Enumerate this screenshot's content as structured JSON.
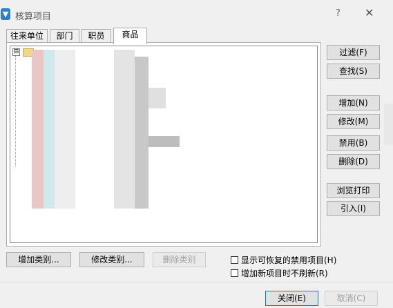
{
  "window": {
    "title": "核算项目",
    "help": "?",
    "close": "✕"
  },
  "tabs": [
    {
      "label": "往来单位"
    },
    {
      "label": "部门"
    },
    {
      "label": "职员"
    },
    {
      "label": "商品"
    }
  ],
  "tree": {
    "root_expander": "⊟"
  },
  "side_buttons": {
    "filter": "过滤(F)",
    "find": "查找(S)",
    "add": "增加(N)",
    "modify": "修改(M)",
    "disable": "禁用(B)",
    "delete": "删除(D)",
    "browse_print": "浏览打印",
    "import": "引入(I)"
  },
  "category_buttons": {
    "add_category": "增加类别...",
    "modify_category": "修改类别...",
    "delete_category": "删除类别"
  },
  "options": {
    "show_recoverable": "显示可恢复的禁用项目(H)",
    "no_refresh": "增加新项目时不刷新(R)"
  },
  "dialog_buttons": {
    "close": "关闭(E)",
    "cancel": "取消(C)"
  }
}
